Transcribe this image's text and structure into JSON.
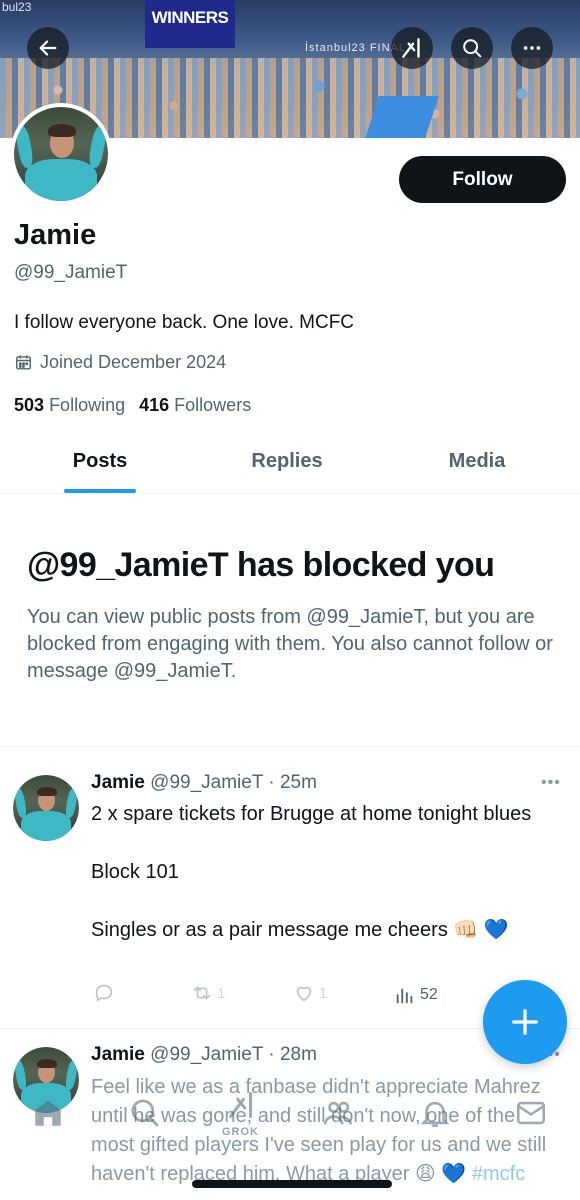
{
  "banner": {
    "sign_text": "WINNERS",
    "istanbul_text": "İstanbul23 FINAL",
    "corner_text": "bul23"
  },
  "topbar": {
    "back_icon": "arrow-left-icon",
    "grok_icon": "grok-icon",
    "search_icon": "search-icon",
    "more_icon": "more-horizontal-icon"
  },
  "profile": {
    "name": "Jamie",
    "handle": "@99_JamieT",
    "bio": "I follow everyone back. One love. MCFC",
    "joined": "Joined December 2024",
    "following_count": "503",
    "following_label": "Following",
    "followers_count": "416",
    "followers_label": "Followers",
    "follow_button": "Follow"
  },
  "tabs": [
    {
      "label": "Posts",
      "active": true
    },
    {
      "label": "Replies",
      "active": false
    },
    {
      "label": "Media",
      "active": false
    }
  ],
  "blocked": {
    "title": "@99_JamieT has blocked you",
    "text": "You can view public posts from @99_JamieT, but you are blocked from engaging with them. You also cannot follow or message @99_JamieT."
  },
  "posts": [
    {
      "author": "Jamie",
      "meta": "@99_JamieT · 25m",
      "lines": [
        "2 x spare tickets for Brugge at home tonight blues",
        "",
        "Block 101",
        "",
        "Singles or as a pair message me cheers 👊🏻 💙"
      ],
      "replies": "",
      "reposts": "1",
      "likes": "1",
      "views": "52"
    },
    {
      "author": "Jamie",
      "meta": "@99_JamieT · 28m",
      "text": "Feel like we as a fanbase didn't appreciate Mahrez until he was gone, and still don't now, one of the most gifted players I've seen play for us and we still haven't replaced him. What a player 😩 💙",
      "hashtag": "#mcfc"
    }
  ],
  "fab": {
    "label": "+"
  },
  "bottom_nav": {
    "grok_label": "GROK"
  },
  "colors": {
    "accent": "#1d9bf0",
    "text_primary": "#0f1419",
    "text_secondary": "#536471"
  }
}
